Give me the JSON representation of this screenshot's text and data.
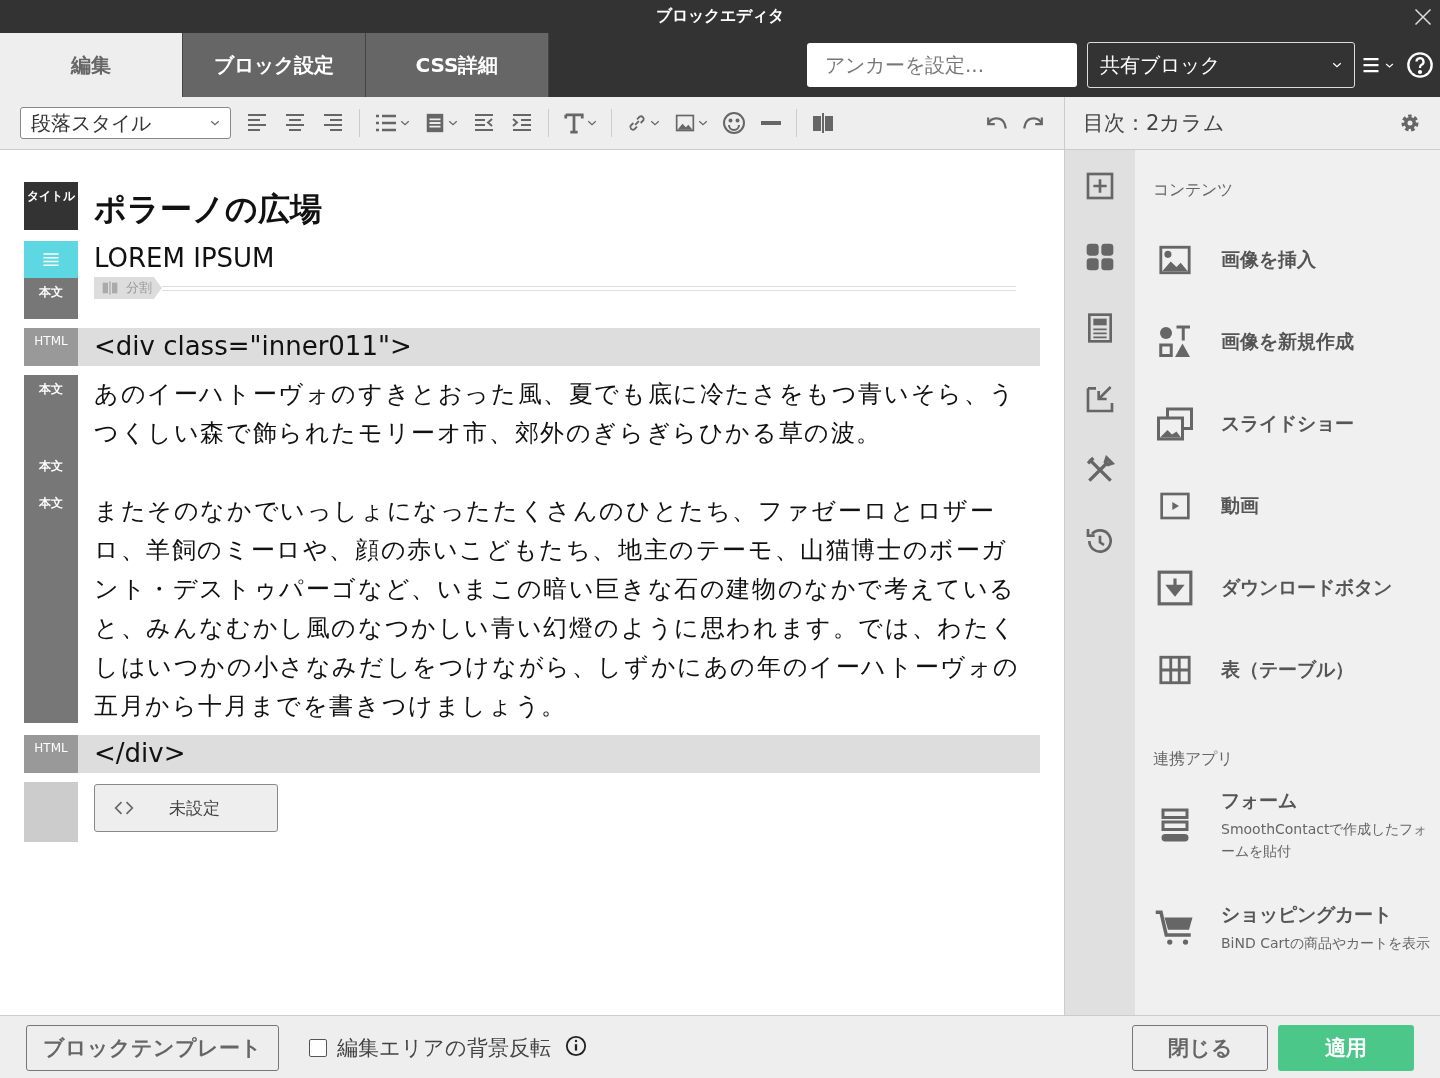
{
  "window": {
    "title": "ブロックエディタ"
  },
  "tabs": [
    {
      "label": "編集",
      "selected": true
    },
    {
      "label": "ブロック設定",
      "selected": false
    },
    {
      "label": "CSS詳細",
      "selected": false
    }
  ],
  "anchor_field": {
    "placeholder": "アンカーを設定..."
  },
  "block_type_select": {
    "value": "共有ブロック"
  },
  "toolbar": {
    "paragraph_style": "段落スタイル"
  },
  "panel_header": {
    "title": "目次：2カラム"
  },
  "blocks": [
    {
      "kind": "title",
      "labels": [
        "タイトル"
      ],
      "text": "ポラーノの広場"
    },
    {
      "kind": "text",
      "labels": [
        "本文"
      ],
      "text": "LOREM IPSUM",
      "divider": "分割"
    },
    {
      "kind": "html",
      "labels": [
        "HTML"
      ],
      "text": "<div class=\"inner011\">"
    },
    {
      "kind": "body",
      "labels": [
        "本文",
        "本文",
        "本文"
      ],
      "paragraphs": [
        "あのイーハトーヴォのすきとおった風、夏でも底に冷たさをもつ青いそら、うつくしい森で飾られたモリーオ市、郊外のぎらぎらひかる草の波。",
        "またそのなかでいっしょになったたくさんのひとたち、ファゼーロとロザーロ、羊飼のミーロや、顔の赤いこどもたち、地主のテーモ、山猫博士のボーガント・デストゥパーゴなど、いまこの暗い巨きな石の建物のなかで考えていると、みんなむかし風のなつかしい青い幻燈のように思われます。では、わたくしはいつかの小さなみだしをつけながら、しずかにあの年のイーハトーヴォの五月から十月までを書きつけましょう。"
      ]
    },
    {
      "kind": "html",
      "labels": [
        "HTML"
      ],
      "text": "</div>"
    },
    {
      "kind": "empty",
      "text": "未設定"
    }
  ],
  "sections": [
    {
      "title": "コンテンツ",
      "items": [
        {
          "label": "画像を挿入"
        },
        {
          "label": "画像を新規作成"
        },
        {
          "label": "スライドショー"
        },
        {
          "label": "動画"
        },
        {
          "label": "ダウンロードボタン"
        },
        {
          "label": "表（テーブル）"
        }
      ]
    },
    {
      "title": "連携アプリ",
      "items": [
        {
          "label": "フォーム",
          "description": "SmoothContactで作成したフォームを貼付"
        },
        {
          "label": "ショッピングカート",
          "description": "BiND Cartの商品やカートを表示"
        }
      ]
    }
  ],
  "footer": {
    "template_button": "ブロックテンプレート",
    "invert_checkbox": {
      "label": "編集エリアの背景反転",
      "checked": false
    },
    "close_button": "閉じる",
    "apply_button": "適用"
  }
}
